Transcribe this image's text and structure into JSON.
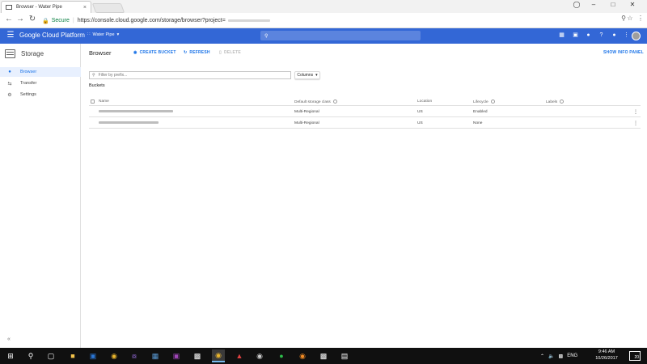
{
  "browser": {
    "tab_title": "Browser - Water Pipe",
    "tab_close": "×",
    "secure_label": "Secure",
    "url": "https://console.cloud.google.com/storage/browser?project="
  },
  "header": {
    "app_title": "Google Cloud Platform",
    "project": "Water Pipe"
  },
  "sidebar": {
    "section_title": "Storage",
    "items": [
      {
        "label": "Browser",
        "icon": "bucket-icon",
        "active": true
      },
      {
        "label": "Transfer",
        "icon": "transfer-icon",
        "active": false
      },
      {
        "label": "Settings",
        "icon": "gear-icon",
        "active": false
      }
    ]
  },
  "main": {
    "title": "Browser",
    "create_bucket": "CREATE BUCKET",
    "refresh": "REFRESH",
    "delete": "DELETE",
    "show_info_panel": "SHOW INFO PANEL",
    "filter_placeholder": "Filter by prefix...",
    "columns_label": "Columns",
    "buckets_label": "Buckets",
    "table": {
      "headers": [
        "Name",
        "Default storage class",
        "Location",
        "Lifecycle",
        "Labels"
      ],
      "rows": [
        {
          "storage_class": "Multi-Regional",
          "location": "US",
          "lifecycle": "Enabled"
        },
        {
          "storage_class": "Multi-Regional",
          "location": "US",
          "lifecycle": "None"
        }
      ]
    }
  },
  "taskbar": {
    "language": "ENG",
    "time": "9:46 AM",
    "date": "10/26/2017",
    "notification_count": "20"
  },
  "colors": {
    "gcp_blue": "#3367d6",
    "link_blue": "#1a73e8",
    "taskbar": "#101010"
  }
}
